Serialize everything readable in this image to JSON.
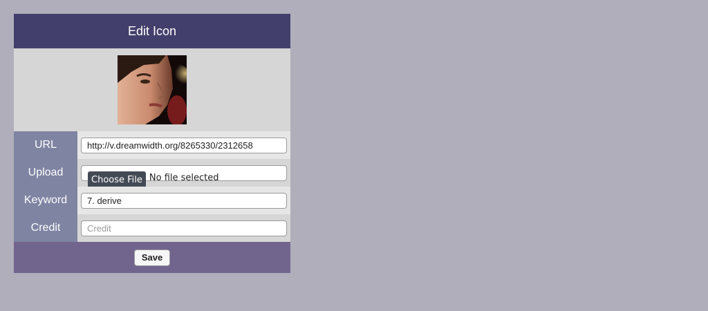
{
  "header": {
    "title": "Edit Icon"
  },
  "preview": {
    "icon": "portrait-icon"
  },
  "form": {
    "url": {
      "label": "URL",
      "value": "http://v.dreamwidth.org/8265330/2312658"
    },
    "upload": {
      "label": "Upload",
      "button_label": "Choose File",
      "status": "No file selected"
    },
    "keyword": {
      "label": "Keyword",
      "value": "7. derive"
    },
    "credit": {
      "label": "Credit",
      "value": "",
      "placeholder": "Credit"
    }
  },
  "footer": {
    "save_label": "Save"
  },
  "colors": {
    "page_background": "#b0aeba",
    "header": "#433f6c",
    "label_column": "#7f84a2",
    "footer": "#71658e"
  }
}
